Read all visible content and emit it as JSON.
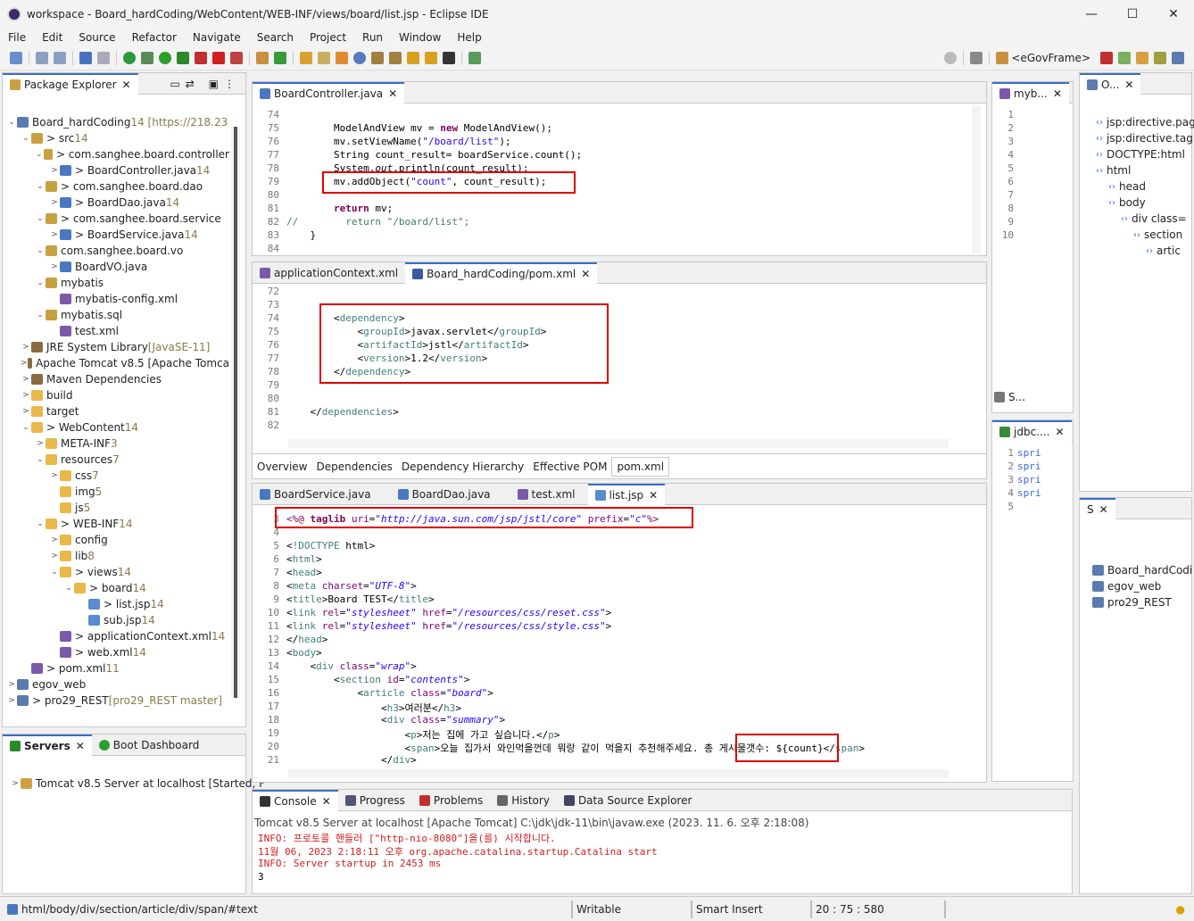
{
  "window": {
    "title": "workspace - Board_hardCoding/WebContent/WEB-INF/views/board/list.jsp - Eclipse IDE",
    "minimize": "—",
    "maximize": "☐",
    "close": "✕"
  },
  "menu": [
    "File",
    "Edit",
    "Source",
    "Refactor",
    "Navigate",
    "Search",
    "Project",
    "Run",
    "Window",
    "Help"
  ],
  "toolbar": {
    "perspective": "<eGovFrame>"
  },
  "package_explorer": {
    "title": "Package Explorer",
    "rows": [
      {
        "d": 0,
        "tw": "⌄",
        "ico": "proj",
        "text": "Board_hardCoding",
        "extra": " 14 [https://218.23"
      },
      {
        "d": 1,
        "tw": "⌄",
        "ico": "pkg",
        "text": "> src",
        "extra": " 14"
      },
      {
        "d": 2,
        "tw": "⌄",
        "ico": "pkg",
        "text": "> com.sanghee.board.controller",
        "extra": ""
      },
      {
        "d": 3,
        "tw": ">",
        "ico": "jf",
        "text": "> BoardController.java",
        "extra": " 14"
      },
      {
        "d": 2,
        "tw": "⌄",
        "ico": "pkg",
        "text": "> com.sanghee.board.dao",
        "extra": ""
      },
      {
        "d": 3,
        "tw": ">",
        "ico": "jf",
        "text": "> BoardDao.java",
        "extra": " 14"
      },
      {
        "d": 2,
        "tw": "⌄",
        "ico": "pkg",
        "text": "> com.sanghee.board.service",
        "extra": ""
      },
      {
        "d": 3,
        "tw": ">",
        "ico": "jf",
        "text": "> BoardService.java",
        "extra": " 14"
      },
      {
        "d": 2,
        "tw": "⌄",
        "ico": "pkg",
        "text": "com.sanghee.board.vo",
        "extra": ""
      },
      {
        "d": 3,
        "tw": ">",
        "ico": "jf",
        "text": "BoardVO.java",
        "extra": ""
      },
      {
        "d": 2,
        "tw": "⌄",
        "ico": "pkg",
        "text": "mybatis",
        "extra": ""
      },
      {
        "d": 3,
        "tw": "",
        "ico": "xmlf",
        "text": "mybatis-config.xml",
        "extra": ""
      },
      {
        "d": 2,
        "tw": "⌄",
        "ico": "pkg",
        "text": "mybatis.sql",
        "extra": ""
      },
      {
        "d": 3,
        "tw": "",
        "ico": "xmlf",
        "text": "test.xml",
        "extra": ""
      },
      {
        "d": 1,
        "tw": ">",
        "ico": "lib",
        "text": "JRE System Library",
        "extra": " [JavaSE-11]"
      },
      {
        "d": 1,
        "tw": ">",
        "ico": "lib",
        "text": "Apache Tomcat v8.5 [Apache Tomca",
        "extra": ""
      },
      {
        "d": 1,
        "tw": ">",
        "ico": "lib",
        "text": "Maven Dependencies",
        "extra": ""
      },
      {
        "d": 1,
        "tw": ">",
        "ico": "fold",
        "text": "build",
        "extra": ""
      },
      {
        "d": 1,
        "tw": ">",
        "ico": "fold",
        "text": "target",
        "extra": ""
      },
      {
        "d": 1,
        "tw": "⌄",
        "ico": "fold",
        "text": "> WebContent",
        "extra": " 14"
      },
      {
        "d": 2,
        "tw": ">",
        "ico": "fold",
        "text": "META-INF",
        "extra": " 3"
      },
      {
        "d": 2,
        "tw": "⌄",
        "ico": "fold",
        "text": "resources",
        "extra": " 7"
      },
      {
        "d": 3,
        "tw": ">",
        "ico": "fold",
        "text": "css",
        "extra": " 7"
      },
      {
        "d": 3,
        "tw": "",
        "ico": "fold",
        "text": "img",
        "extra": " 5"
      },
      {
        "d": 3,
        "tw": "",
        "ico": "fold",
        "text": "js",
        "extra": " 5"
      },
      {
        "d": 2,
        "tw": "⌄",
        "ico": "fold",
        "text": "> WEB-INF",
        "extra": " 14"
      },
      {
        "d": 3,
        "tw": ">",
        "ico": "fold",
        "text": "config",
        "extra": ""
      },
      {
        "d": 3,
        "tw": ">",
        "ico": "fold",
        "text": "lib",
        "extra": " 8"
      },
      {
        "d": 3,
        "tw": "⌄",
        "ico": "fold",
        "text": "> views",
        "extra": " 14"
      },
      {
        "d": 4,
        "tw": "⌄",
        "ico": "fold",
        "text": "> board",
        "extra": " 14"
      },
      {
        "d": 5,
        "tw": "",
        "ico": "jsp",
        "text": "> list.jsp",
        "extra": " 14"
      },
      {
        "d": 5,
        "tw": "",
        "ico": "jsp",
        "text": "sub.jsp",
        "extra": " 14"
      },
      {
        "d": 3,
        "tw": "",
        "ico": "xmlf",
        "text": "> applicationContext.xml",
        "extra": " 14"
      },
      {
        "d": 3,
        "tw": "",
        "ico": "xmlf",
        "text": "> web.xml",
        "extra": " 14"
      },
      {
        "d": 1,
        "tw": "",
        "ico": "xmlf",
        "text": "> pom.xml",
        "extra": " 11"
      },
      {
        "d": 0,
        "tw": ">",
        "ico": "proj",
        "text": "egov_web",
        "extra": ""
      },
      {
        "d": 0,
        "tw": ">",
        "ico": "proj",
        "text": "> pro29_REST",
        "extra": " [pro29_REST master]"
      }
    ]
  },
  "servers": {
    "tab1": "Servers",
    "tab2": "Boot Dashboard",
    "row": "Tomcat v8.5 Server at localhost  [Started, F"
  },
  "editor1": {
    "tab": "BoardController.java",
    "lines": [
      {
        "n": "74",
        "h": ""
      },
      {
        "n": "75",
        "h": "        <span style='color:#000'>ModelAndView mv = </span><span class='kw'>new</span> ModelAndView();"
      },
      {
        "n": "76",
        "h": "        mv.setViewName(<span class='str'>\"/board/list\"</span>);"
      },
      {
        "n": "77",
        "h": "        String count_result= boardService.count();"
      },
      {
        "n": "78",
        "h": "        System.<i>out</i>.println(count_result);"
      },
      {
        "n": "79",
        "h": "        mv.addObject(<span class='str'>\"count\"</span>, count_result);"
      },
      {
        "n": "80",
        "h": ""
      },
      {
        "n": "81",
        "h": "        <span class='kw'>return</span> mv;"
      },
      {
        "n": "82",
        "h": "<span class='cm'>//        return \"/board/list\";</span>"
      },
      {
        "n": "83",
        "h": "    }"
      },
      {
        "n": "84",
        "h": ""
      }
    ]
  },
  "editor2": {
    "tab1": "applicationContext.xml",
    "tab2": "Board_hardCoding/pom.xml",
    "bottom_tabs": [
      "Overview",
      "Dependencies",
      "Dependency Hierarchy",
      "Effective POM",
      "pom.xml"
    ],
    "lines": [
      {
        "n": "72",
        "h": ""
      },
      {
        "n": "73",
        "h": ""
      },
      {
        "n": "74",
        "h": "        &lt;<span class='tag'>dependency</span>&gt;"
      },
      {
        "n": "75",
        "h": "            &lt;<span class='tag'>groupId</span>&gt;javax.servlet&lt;/<span class='tag'>groupId</span>&gt;"
      },
      {
        "n": "76",
        "h": "            &lt;<span class='tag'>artifactId</span>&gt;jstl&lt;/<span class='tag'>artifactId</span>&gt;"
      },
      {
        "n": "77",
        "h": "            &lt;<span class='tag'>version</span>&gt;1.2&lt;/<span class='tag'>version</span>&gt;"
      },
      {
        "n": "78",
        "h": "        &lt;/<span class='tag'>dependency</span>&gt;"
      },
      {
        "n": "79",
        "h": ""
      },
      {
        "n": "80",
        "h": ""
      },
      {
        "n": "81",
        "h": "    &lt;/<span class='tag'>dependencies</span>&gt;"
      },
      {
        "n": "82",
        "h": ""
      }
    ]
  },
  "editor3": {
    "tabs": [
      "BoardService.java",
      "BoardDao.java",
      "test.xml",
      "list.jsp"
    ],
    "lines": [
      {
        "n": "3",
        "h": "<span style='color:#7f0055'>&lt;%@</span> <span class='kw'>taglib</span> <span class='attr'>uri</span>=<span class='strI'>\"http://java.sun.com/jsp/jstl/core\"</span> <span class='attr'>prefix</span>=<span class='strI'>\"c\"</span><span style='color:#7f0055'>%&gt;</span>"
      },
      {
        "n": "4",
        "h": ""
      },
      {
        "n": "5",
        "h": "&lt;<span class='tag'>!DOCTYPE</span> html&gt;"
      },
      {
        "n": "6",
        "h": "&lt;<span class='tag'>html</span>&gt;"
      },
      {
        "n": "7",
        "h": "&lt;<span class='tag'>head</span>&gt;"
      },
      {
        "n": "8",
        "h": "&lt;<span class='tag'>meta</span> <span class='attr'>charset</span>=<span class='strI'>\"UTF-8\"</span>&gt;"
      },
      {
        "n": "9",
        "h": "&lt;<span class='tag'>title</span>&gt;Board TEST&lt;/<span class='tag'>title</span>&gt;"
      },
      {
        "n": "10",
        "h": "&lt;<span class='tag'>link</span> <span class='attr'>rel</span>=<span class='strI'>\"stylesheet\"</span> <span class='attr'>href</span>=<span class='strI'>\"/resources/css/reset.css\"</span>&gt;"
      },
      {
        "n": "11",
        "h": "&lt;<span class='tag'>link</span> <span class='attr'>rel</span>=<span class='strI'>\"stylesheet\"</span> <span class='attr'>href</span>=<span class='strI'>\"/resources/css/style.css\"</span>&gt;"
      },
      {
        "n": "12",
        "h": "&lt;/<span class='tag'>head</span>&gt;"
      },
      {
        "n": "13",
        "h": "&lt;<span class='tag'>body</span>&gt;"
      },
      {
        "n": "14",
        "h": "    &lt;<span class='tag'>div</span> <span class='attr'>class</span>=<span class='strI'>\"wrap\"</span>&gt;"
      },
      {
        "n": "15",
        "h": "        &lt;<span class='tag'>section</span> <span class='attr'>id</span>=<span class='strI'>\"contents\"</span>&gt;"
      },
      {
        "n": "16",
        "h": "            &lt;<span class='tag'>article</span> <span class='attr'>class</span>=<span class='strI'>\"board\"</span>&gt;"
      },
      {
        "n": "17",
        "h": "                &lt;<span class='tag'>h3</span>&gt;여러분&lt;/<span class='tag'>h3</span>&gt;"
      },
      {
        "n": "18",
        "h": "                &lt;<span class='tag'>div</span> <span class='attr'>class</span>=<span class='strI'>\"summary\"</span>&gt;"
      },
      {
        "n": "19",
        "h": "                    &lt;<span class='tag'>p</span>&gt;저는 집에 가고 싶습니다.&lt;/<span class='tag'>p</span>&gt;"
      },
      {
        "n": "20",
        "h": "                    &lt;<span class='tag'>span</span>&gt;오늘 집가서 와인먹을껀데 뭐랑 같이 먹을지 추천해주세요. 총 게시물갯수: ${count}&lt;/<span class='tag'>span</span>&gt;"
      },
      {
        "n": "21",
        "h": "                &lt;/<span class='tag'>div</span>&gt;"
      }
    ]
  },
  "right_editor": {
    "tab": "myb...",
    "lines": [
      "1",
      "2",
      "3",
      "4",
      "5",
      "6",
      "7",
      "8",
      "9",
      "10"
    ],
    "bottom_tab": "S...",
    "second_tab": "jdbc....",
    "second_lines": [
      "1",
      "2",
      "3",
      "4",
      "5"
    ],
    "second_text": "spri"
  },
  "outline": {
    "tab": "O...",
    "rows": [
      {
        "d": 1,
        "t": "jsp:directive.pag"
      },
      {
        "d": 1,
        "t": "jsp:directive.tag"
      },
      {
        "d": 1,
        "t": "DOCTYPE:html"
      },
      {
        "d": 1,
        "t": "html"
      },
      {
        "d": 2,
        "t": "head"
      },
      {
        "d": 2,
        "t": "body"
      },
      {
        "d": 3,
        "t": "div class="
      },
      {
        "d": 4,
        "t": "section"
      },
      {
        "d": 5,
        "t": "artic"
      }
    ]
  },
  "small_panel": {
    "tab": "S",
    "rows": [
      "Board_hardCodi",
      "egov_web",
      "pro29_REST"
    ]
  },
  "console": {
    "tabs": [
      "Console",
      "Progress",
      "Problems",
      "History",
      "Data Source Explorer"
    ],
    "header": "Tomcat v8.5 Server at localhost [Apache Tomcat] C:\\jdk\\jdk-11\\bin\\javaw.exe  (2023. 11. 6. 오후 2:18:08)",
    "lines": [
      "INFO: 프로토콜 핸들러 [\"http-nio-8080\"]을(를) 시작합니다.",
      "11월 06, 2023 2:18:11 오후 org.apache.catalina.startup.Catalina start",
      "INFO: Server startup in 2453 ms",
      "3"
    ]
  },
  "status": {
    "path": "html/body/div/section/article/div/span/#text",
    "writable": "Writable",
    "insert": "Smart Insert",
    "pos": "20 : 75 : 580"
  }
}
